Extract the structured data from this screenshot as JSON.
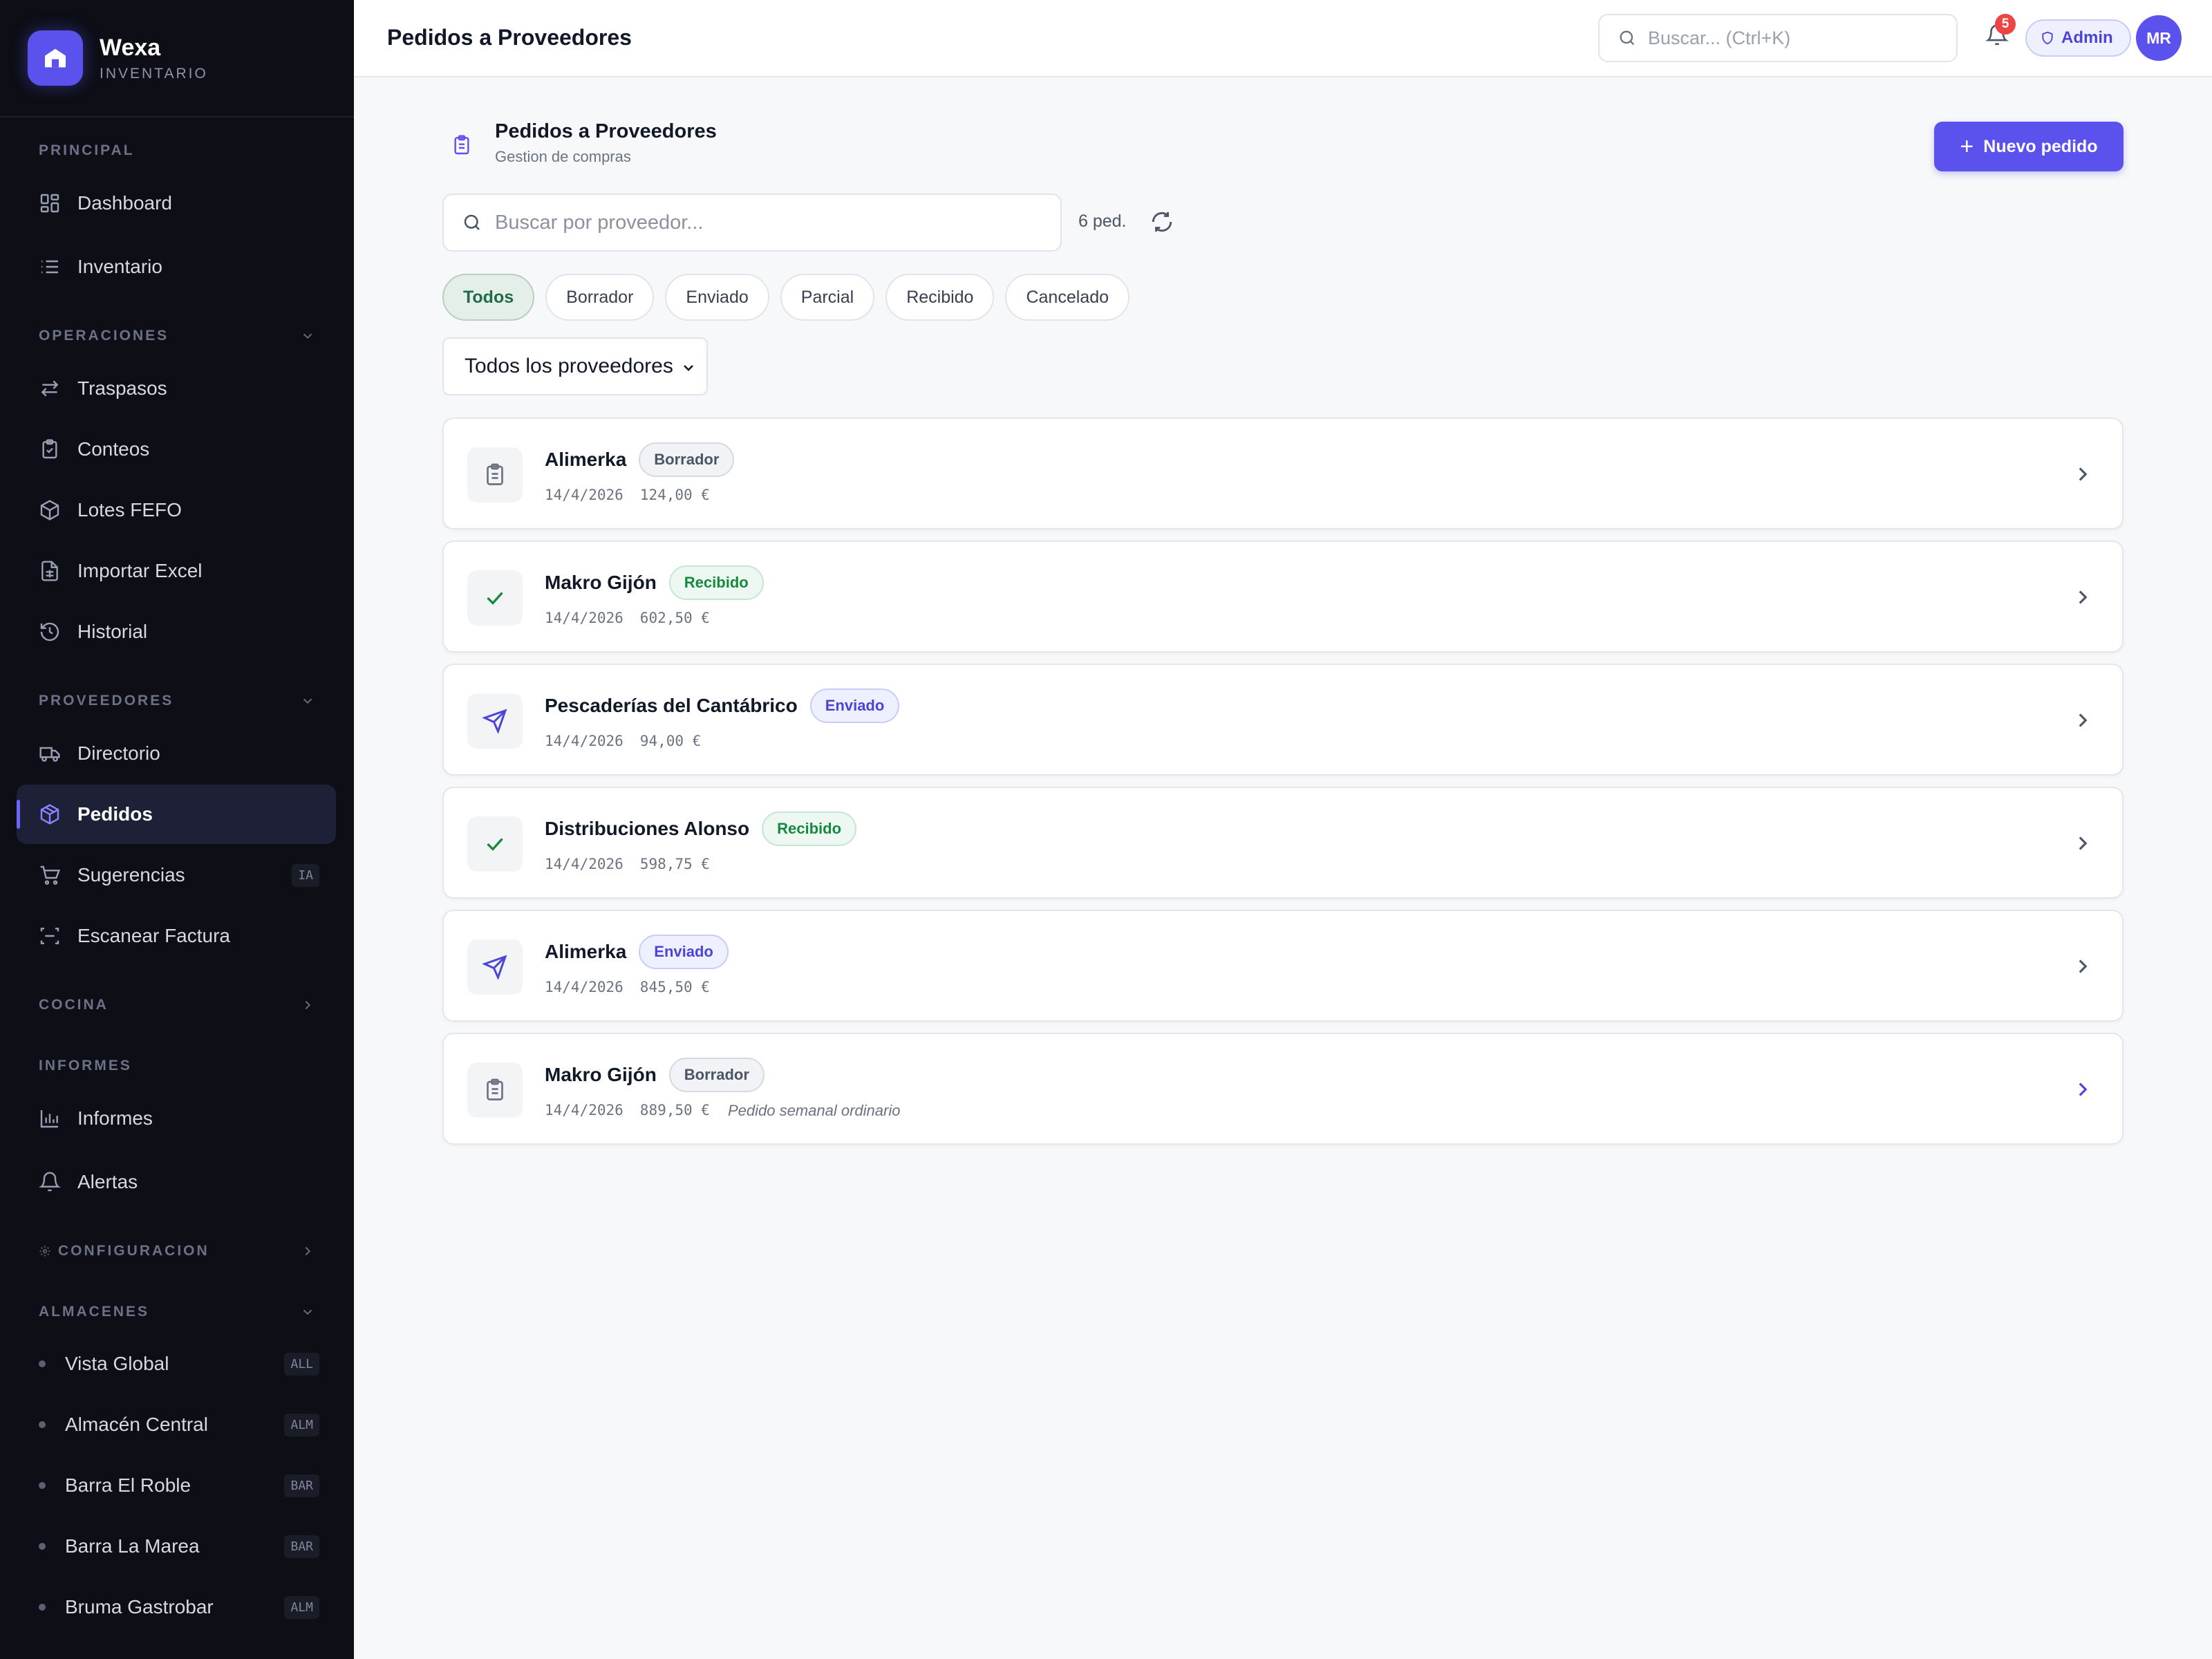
{
  "brand": {
    "name": "Wexa",
    "subtitle": "INVENTARIO"
  },
  "sidebar": {
    "sections": {
      "principal": "PRINCIPAL",
      "operaciones": "OPERACIONES",
      "proveedores": "PROVEEDORES",
      "cocina": "COCINA",
      "informes": "INFORMES",
      "configuracion": "CONFIGURACION",
      "almacenes": "ALMACENES"
    },
    "items": [
      {
        "label": "Dashboard",
        "icon": "dashboard-icon"
      },
      {
        "label": "Inventario",
        "icon": "list-icon"
      },
      {
        "label": "Traspasos",
        "icon": "transfer-icon"
      },
      {
        "label": "Conteos",
        "icon": "clipboard-icon"
      },
      {
        "label": "Lotes FEFO",
        "icon": "box-icon"
      },
      {
        "label": "Importar Excel",
        "icon": "spreadsheet-icon"
      },
      {
        "label": "Historial",
        "icon": "history-icon"
      },
      {
        "label": "Directorio",
        "icon": "truck-icon"
      },
      {
        "label": "Pedidos",
        "icon": "package-icon",
        "active": true
      },
      {
        "label": "Sugerencias",
        "icon": "cart-icon",
        "tag": "IA"
      },
      {
        "label": "Escanear Factura",
        "icon": "scan-icon"
      },
      {
        "label": "Informes",
        "icon": "bar-chart-icon"
      },
      {
        "label": "Alertas",
        "icon": "bell-icon"
      }
    ],
    "warehouses": [
      {
        "label": "Vista Global",
        "tag": "ALL"
      },
      {
        "label": "Almacén Central",
        "tag": "ALM"
      },
      {
        "label": "Barra El Roble",
        "tag": "BAR"
      },
      {
        "label": "Barra La Marea",
        "tag": "BAR"
      },
      {
        "label": "Bruma Gastrobar",
        "tag": "ALM"
      }
    ]
  },
  "topbar": {
    "title": "Pedidos a Proveedores",
    "search_placeholder": "Buscar... (Ctrl+K)",
    "notifications": "5",
    "role": "Admin",
    "avatar": "MR"
  },
  "main": {
    "header_title": "Pedidos a Proveedores",
    "header_subtitle": "Gestion de compras",
    "new_button": "Nuevo pedido",
    "search_placeholder": "Buscar por proveedor...",
    "count": "6 ped.",
    "filters": [
      "Todos",
      "Borrador",
      "Enviado",
      "Parcial",
      "Recibido",
      "Cancelado"
    ],
    "active_filter": "Todos",
    "supplier_select": "Todos los proveedores",
    "orders": [
      {
        "supplier": "Alimerka",
        "status": "Borrador",
        "date": "14/4/2026",
        "amount": "124,00 €",
        "note": ""
      },
      {
        "supplier": "Makro Gijón",
        "status": "Recibido",
        "date": "14/4/2026",
        "amount": "602,50 €",
        "note": ""
      },
      {
        "supplier": "Pescaderías del Cantábrico",
        "status": "Enviado",
        "date": "14/4/2026",
        "amount": "94,00 €",
        "note": ""
      },
      {
        "supplier": "Distribuciones Alonso",
        "status": "Recibido",
        "date": "14/4/2026",
        "amount": "598,75 €",
        "note": ""
      },
      {
        "supplier": "Alimerka",
        "status": "Enviado",
        "date": "14/4/2026",
        "amount": "845,50 €",
        "note": ""
      },
      {
        "supplier": "Makro Gijón",
        "status": "Borrador",
        "date": "14/4/2026",
        "amount": "889,50 €",
        "note": "Pedido semanal ordinario"
      }
    ]
  },
  "colors": {
    "accent": "#5b52ee",
    "sidebar_bg": "#0d0e16",
    "success": "#17893f",
    "danger": "#ef4444"
  }
}
